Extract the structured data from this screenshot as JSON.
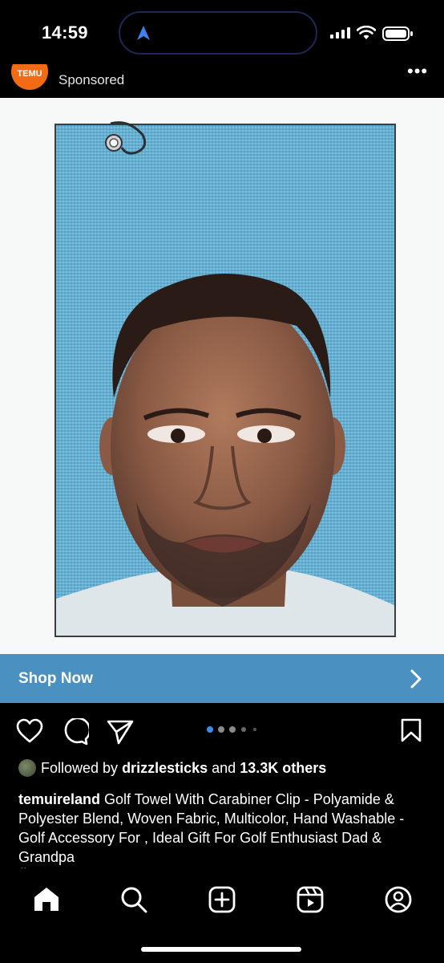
{
  "status_bar": {
    "time": "14:59"
  },
  "post": {
    "advertiser_logo_text": "TEMU",
    "sponsored_label": "Sponsored",
    "more_label": "•••",
    "cta_label": "Shop Now",
    "carousel": {
      "total": 5,
      "active_index": 0
    },
    "followed_by": {
      "prefix": "Followed by",
      "user": "drizzlesticks",
      "joiner": "and",
      "others": "13.3K others"
    },
    "caption": {
      "username": "temuireland",
      "text": "Golf Towel With Carabiner Clip - Polyamide & Polyester Blend, Woven Fabric, Multicolor, Hand Washable - Golf Accessory For , Ideal Gift For Golf Enthusiast Dad & Grandpa"
    },
    "hashtag_partial": "#...... ...  ...... ..........   ......"
  },
  "colors": {
    "cta_bar": "#4a90c0",
    "temu_orange": "#f46b16",
    "towel_blue": "#5fb1d8",
    "carousel_active": "#3b8cf0"
  },
  "icons": {
    "nav_home": "home-icon",
    "action_like": "heart-icon",
    "action_comment": "comment-icon",
    "action_share": "send-icon",
    "action_save": "bookmark-icon"
  }
}
